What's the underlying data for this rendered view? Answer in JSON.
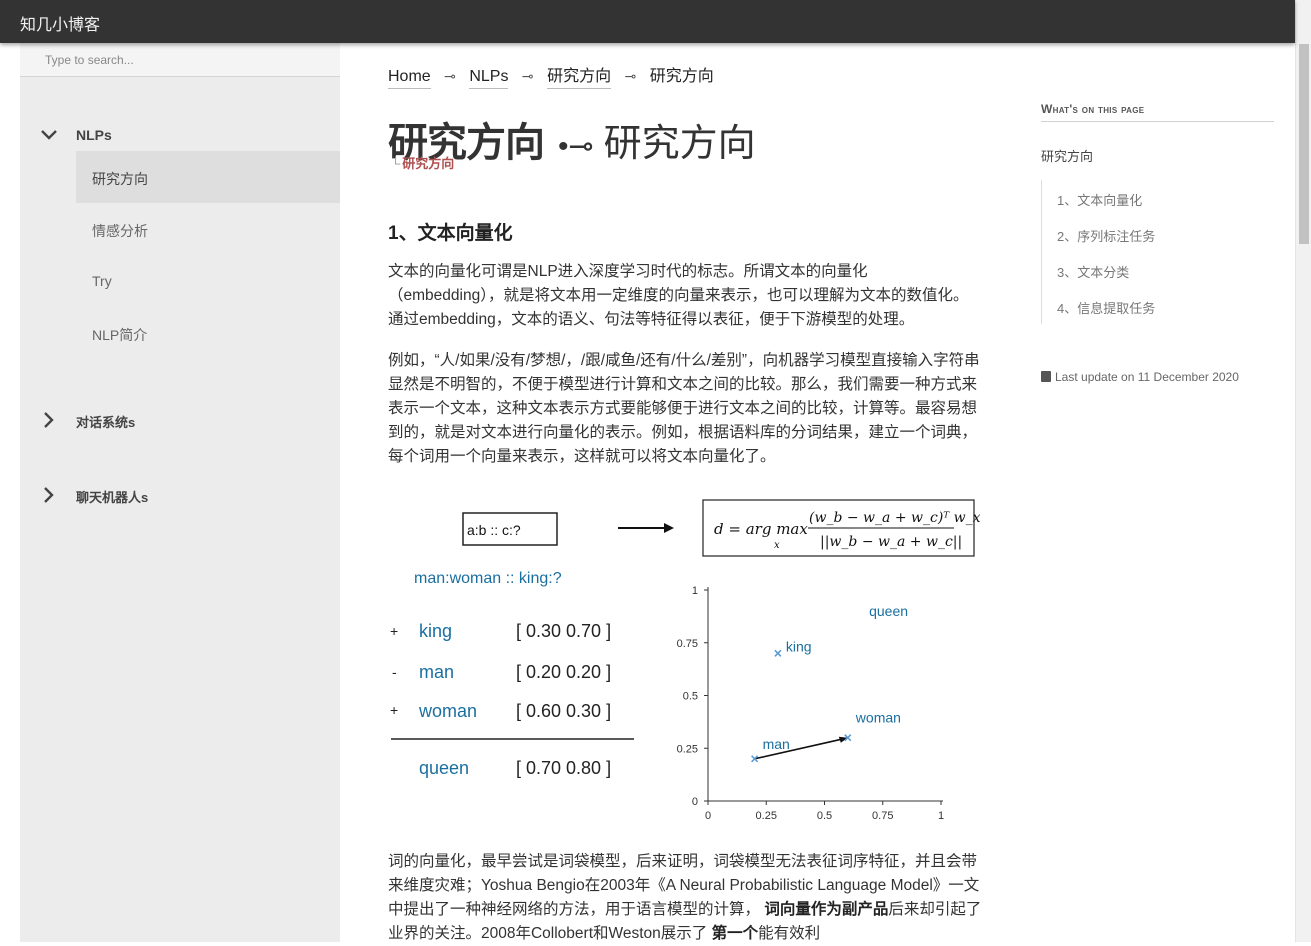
{
  "site": {
    "brand": "知几小博客"
  },
  "search": {
    "placeholder": "Type to search..."
  },
  "sidebar": {
    "sections": [
      {
        "label": "NLPs",
        "expanded": true,
        "items": [
          {
            "label": "研究方向",
            "active": true
          },
          {
            "label": "情感分析"
          },
          {
            "label": "Try"
          },
          {
            "label": "NLP简介"
          }
        ]
      },
      {
        "label": "对话系统s",
        "expanded": false
      },
      {
        "label": "聊天机器人s",
        "expanded": false
      }
    ]
  },
  "breadcrumb": {
    "items": [
      "Home",
      "NLPs",
      "研究方向",
      "研究方向"
    ],
    "separator": "⊸"
  },
  "page": {
    "title_bold": "研究方向",
    "title_sep": "•⊸",
    "title_light": "研究方向",
    "subtitle_prefix": "└",
    "subtitle": "研究方向"
  },
  "content": {
    "h2": "1、文本向量化",
    "p1": "文本的向量化可谓是NLP进入深度学习时代的标志。所谓文本的向量化（embedding），就是将文本用一定维度的向量来表示，也可以理解为文本的数值化。通过embedding，文本的语义、句法等特征得以表征，便于下游模型的处理。",
    "p2": "例如，“人/如果/没有/梦想/，/跟/咸鱼/还有/什么/差别”，向机器学习模型直接输入字符串显然是不明智的，不便于模型进行计算和文本之间的比较。那么，我们需要一种方式来表示一个文本，这种文本表示方式要能够便于进行文本之间的比较，计算等。最容易想到的，就是对文本进行向量化的表示。例如，根据语料库的分词结果，建立一个词典，每个词用一个向量来表示，这样就可以将文本向量化了。",
    "p3_a": "词的向量化，最早尝试是词袋模型，后来证明，词袋模型无法表征词序特征，并且会带来维度灾难；Yoshua Bengio在2003年《A Neural Probabilistic Language Model》一文中提出了一种神经网络的方法，用于语言模型的计算， ",
    "p3_b": "词向量作为副产品",
    "p3_c": "后来却引起了业界的关注。2008年Collobert和Weston展示了 ",
    "p3_d": "第一个",
    "p3_e": "能有效利"
  },
  "figure": {
    "analogy_box": "a:b :: c:?",
    "formula_lhs": "d = arg max",
    "formula_sub": "x",
    "formula_num": "(w_b − w_a + w_c)ᵀ w_x",
    "formula_den": "||w_b − w_a + w_c||",
    "question": "man:woman :: king:?",
    "rows": [
      {
        "op": "+",
        "word": "king",
        "vec": "[ 0.30 0.70 ]"
      },
      {
        "op": "-",
        "word": "man",
        "vec": "[ 0.20 0.20 ]"
      },
      {
        "op": "+",
        "word": "woman",
        "vec": "[ 0.60 0.30 ]"
      }
    ],
    "result": {
      "word": "queen",
      "vec": "[ 0.70 0.80 ]"
    },
    "plot": {
      "xticks": [
        "0",
        "0.25",
        "0.5",
        "0.75",
        "1"
      ],
      "yticks": [
        "0",
        "0.25",
        "0.5",
        "0.75",
        "1"
      ],
      "points": [
        {
          "label": "king",
          "x": 0.3,
          "y": 0.7
        },
        {
          "label": "man",
          "x": 0.2,
          "y": 0.2
        },
        {
          "label": "woman",
          "x": 0.6,
          "y": 0.3
        },
        {
          "label": "queen",
          "x": 0.7,
          "y": 0.8
        }
      ],
      "colors": {
        "word": "#1a6fa0",
        "point": "#5b9bd5"
      }
    }
  },
  "toc": {
    "heading": "What's on this page",
    "root": "研究方向",
    "items": [
      "1、文本向量化",
      "2、序列标注任务",
      "3、文本分类",
      "4、信息提取任务"
    ]
  },
  "last_update": "Last update on 11 December 2020"
}
